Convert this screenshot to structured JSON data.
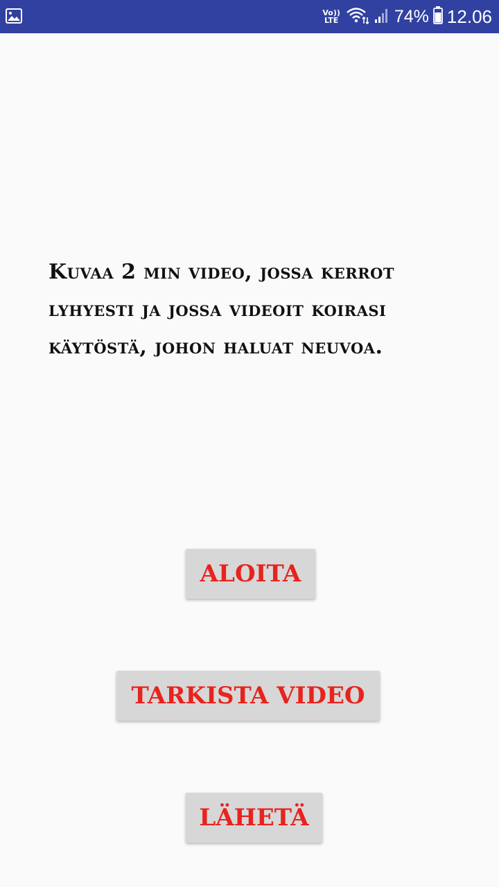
{
  "status_bar": {
    "left_icon": "image-icon",
    "volte_top": "Vo))",
    "volte_bottom": "LTE",
    "battery_percent": "74%",
    "time": "12.06"
  },
  "main": {
    "instruction": "Kuvaa 2 min video, jossa kerrot lyhyesti ja jossa videoit koirasi käytöstä, johon haluat neuvoa."
  },
  "buttons": {
    "start_label": "ALOITA",
    "check_label": "TARKISTA VIDEO",
    "send_label": "LÄHETÄ"
  },
  "colors": {
    "status_bar_bg": "#3141a1",
    "button_bg": "#d7d7d7",
    "button_text": "#e8231e",
    "page_bg": "#fafafa"
  }
}
